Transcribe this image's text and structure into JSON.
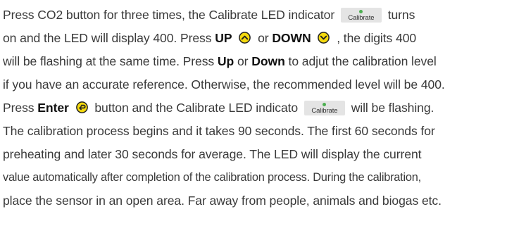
{
  "lines": [
    {
      "a": "Press CO2 button for three times, the Calibrate LED indicator",
      "b": "turns"
    },
    {
      "a": "on and the LED will display 400. Press",
      "up": "UP",
      "or": "or",
      "down": "DOWN",
      "b": ", the digits 400"
    },
    {
      "a": "will be flashing at the same time. Press",
      "up": "Up",
      "or": "or",
      "down": "Down",
      "b": "to adjut the calibration level"
    },
    {
      "a": "if you have an accurate reference. Otherwise, the recommended level will be 400."
    },
    {
      "a": "Press",
      "enter": "Enter",
      "b": "button and the Calibrate LED indicato",
      "c": "will be flashing."
    },
    {
      "a": "The calibration process begins and it takes 90 seconds. The first 60 seconds for"
    },
    {
      "a": "preheating and later 30 seconds for average. The LED will display the current"
    },
    {
      "a": "value automatically after completion of the calibration process. During the calibration,"
    },
    {
      "a": "place the sensor in an open area. Far away from people, animals and biogas etc."
    }
  ],
  "led_label": "Calibrate",
  "icons": {
    "up": "up-arrow-circle-icon",
    "down": "down-arrow-circle-icon",
    "enter": "enter-return-circle-icon"
  },
  "colors": {
    "icon_yellow": "#f4d90d",
    "led_green": "#4caf50",
    "led_bg": "#e4e4e4",
    "text": "#3a3a3a"
  }
}
